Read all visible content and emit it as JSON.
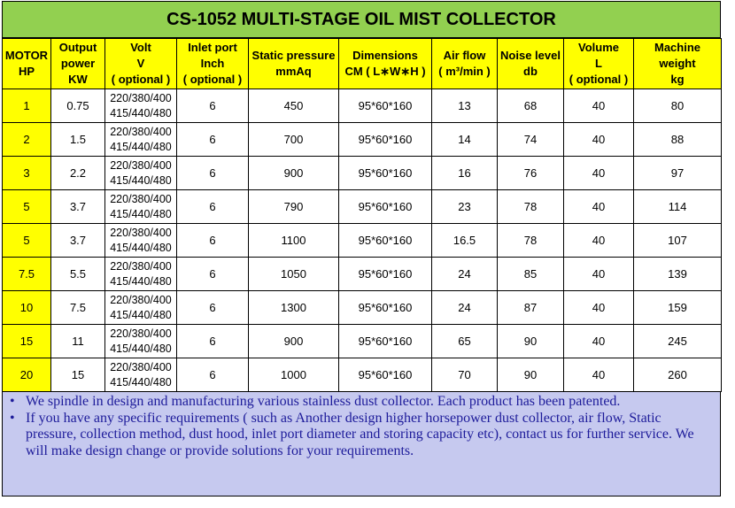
{
  "title": "CS-1052 MULTI-STAGE OIL MIST COLLECTOR",
  "columns": [
    [
      "MOTOR",
      "HP"
    ],
    [
      "Output",
      "power",
      "KW"
    ],
    [
      "Volt",
      "V",
      "( optional )"
    ],
    [
      "Inlet port",
      "Inch",
      "( optional )"
    ],
    [
      "Static pressure",
      "mmAq"
    ],
    [
      "Dimensions",
      "CM ( L∗W∗H )"
    ],
    [
      "Air flow",
      "( m³/min )"
    ],
    [
      "Noise level",
      "db"
    ],
    [
      "Volume",
      "L",
      "( optional )"
    ],
    [
      "Machine",
      "weight",
      "kg"
    ]
  ],
  "rows": [
    [
      "1",
      "0.75",
      [
        "220/380/400",
        "415/440/480"
      ],
      "6",
      "450",
      "95*60*160",
      "13",
      "68",
      "40",
      "80"
    ],
    [
      "2",
      "1.5",
      [
        "220/380/400",
        "415/440/480"
      ],
      "6",
      "700",
      "95*60*160",
      "14",
      "74",
      "40",
      "88"
    ],
    [
      "3",
      "2.2",
      [
        "220/380/400",
        "415/440/480"
      ],
      "6",
      "900",
      "95*60*160",
      "16",
      "76",
      "40",
      "97"
    ],
    [
      "5",
      "3.7",
      [
        "220/380/400",
        "415/440/480"
      ],
      "6",
      "790",
      "95*60*160",
      "23",
      "78",
      "40",
      "114"
    ],
    [
      "5",
      "3.7",
      [
        "220/380/400",
        "415/440/480"
      ],
      "6",
      "1100",
      "95*60*160",
      "16.5",
      "78",
      "40",
      "107"
    ],
    [
      "7.5",
      "5.5",
      [
        "220/380/400",
        "415/440/480"
      ],
      "6",
      "1050",
      "95*60*160",
      "24",
      "85",
      "40",
      "139"
    ],
    [
      "10",
      "7.5",
      [
        "220/380/400",
        "415/440/480"
      ],
      "6",
      "1300",
      "95*60*160",
      "24",
      "87",
      "40",
      "159"
    ],
    [
      "15",
      "11",
      [
        "220/380/400",
        "415/440/480"
      ],
      "6",
      "900",
      "95*60*160",
      "65",
      "90",
      "40",
      "245"
    ],
    [
      "20",
      "15",
      [
        "220/380/400",
        "415/440/480"
      ],
      "6",
      "1000",
      "95*60*160",
      "70",
      "90",
      "40",
      "260"
    ]
  ],
  "notes": [
    "We spindle in design and manufacturing various stainless dust collector. Each product has been patented.",
    "If you have any specific requirements ( such as Another design higher horsepower dust collector, air flow, Static pressure, collection method, dust hood, inlet port diameter and storing capacity etc), contact us for further service. We will make design change or provide solutions for your requirements."
  ],
  "colors": {
    "title_bg": "#92d050",
    "header_bg": "#ffff00",
    "notes_bg": "#c6c9ef",
    "notes_text": "#1d1b9a"
  }
}
